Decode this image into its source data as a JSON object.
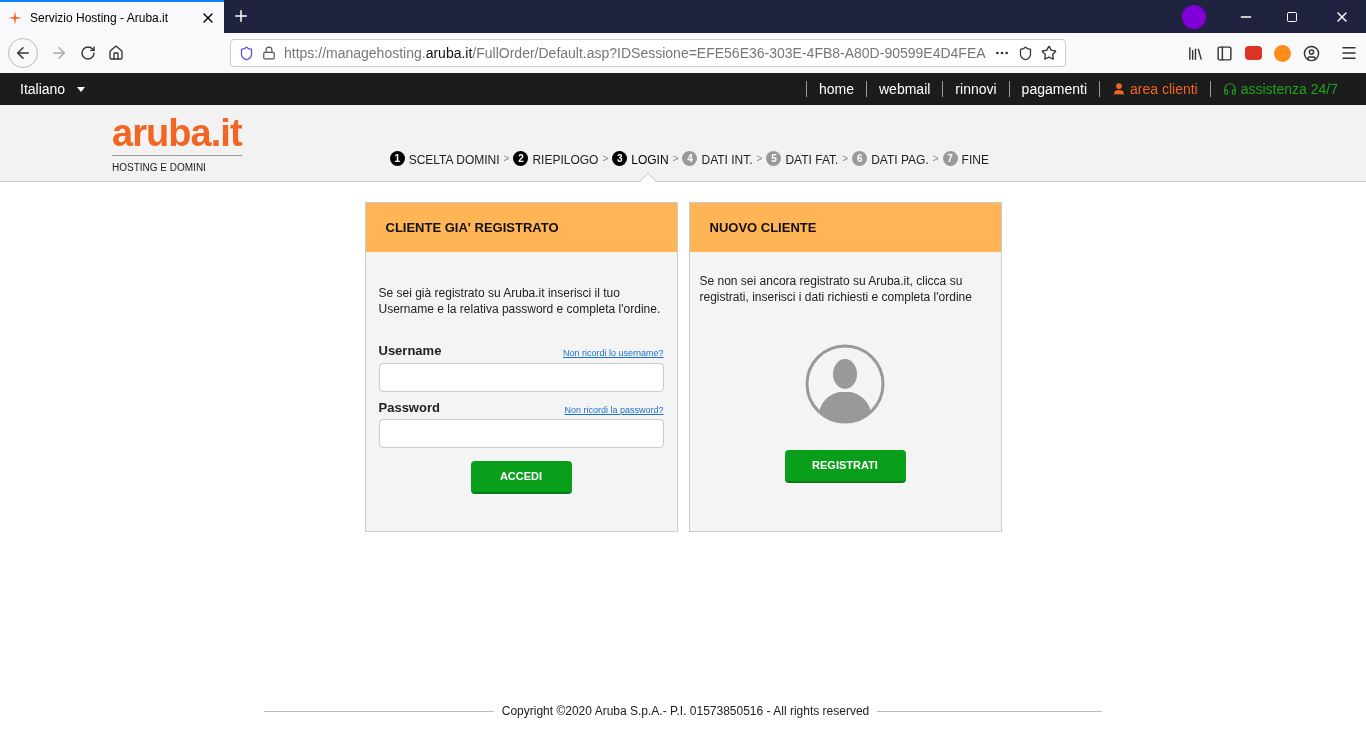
{
  "browser": {
    "tab": {
      "title": "Servizio Hosting - Aruba.it",
      "selected": true
    },
    "url": {
      "prefix": "https://managehosting.",
      "host": "aruba.it",
      "rest": "/FullOrder/Default.asp?IDSessione=EFE56E36-303E-4FB8-A80D-90599E4D4FEA"
    }
  },
  "topbar": {
    "language": "Italiano",
    "links": [
      {
        "label": "home",
        "kind": "plain"
      },
      {
        "label": "webmail",
        "kind": "plain"
      },
      {
        "label": "rinnovi",
        "kind": "plain"
      },
      {
        "label": "pagamenti",
        "kind": "plain"
      },
      {
        "label": "area clienti",
        "kind": "clienti"
      },
      {
        "label": "assistenza 24/7",
        "kind": "assistenza"
      }
    ]
  },
  "header": {
    "logo": "aruba.it",
    "tagline": "HOSTING E DOMINI",
    "steps": [
      {
        "number": "1",
        "label": "SCELTA DOMINI",
        "reached": true,
        "selected": false
      },
      {
        "number": "2",
        "label": "RIEPILOGO",
        "reached": true,
        "selected": false
      },
      {
        "number": "3",
        "label": "LOGIN",
        "reached": true,
        "selected": true
      },
      {
        "number": "4",
        "label": "DATI INT.",
        "reached": false,
        "selected": false
      },
      {
        "number": "5",
        "label": "DATI FAT.",
        "reached": false,
        "selected": false
      },
      {
        "number": "6",
        "label": "DATI PAG.",
        "reached": false,
        "selected": false
      },
      {
        "number": "7",
        "label": "FINE",
        "reached": false,
        "selected": false
      }
    ],
    "separator": ">"
  },
  "login_panel": {
    "title": "CLIENTE GIA' REGISTRATO",
    "text": "Se sei già registrato su Aruba.it inserisci il tuo Username e la relativa password e completa l'ordine.",
    "fields": [
      {
        "label": "Username",
        "link": "Non ricordi lo username?"
      },
      {
        "label": "Password",
        "link": "Non ricordi la password?"
      }
    ],
    "button": "ACCEDI"
  },
  "register_panel": {
    "title": "NUOVO CLIENTE",
    "text": "Se non sei ancora registrato su Aruba.it, clicca su registrati, inserisci i dati richiesti e completa l'ordine",
    "button": "REGISTRATI"
  },
  "footer": "Copyright ©2020 Aruba S.p.A.- P.I. 01573850516 - All rights reserved"
}
